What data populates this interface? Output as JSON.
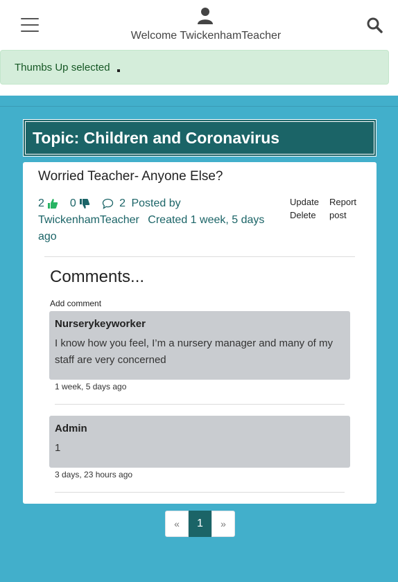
{
  "header": {
    "welcome": "Welcome TwickenhamTeacher"
  },
  "alert": {
    "text": "Thumbs Up selected"
  },
  "topic": {
    "title": "Topic: Children and Coronavirus"
  },
  "post": {
    "title": "Worried Teacher- Anyone Else?",
    "likes": "2",
    "dislikes": "0",
    "comment_count": "2",
    "posted_by_label": "Posted by",
    "author": "TwickenhamTeacher",
    "created": "Created 1 week, 5 days ago",
    "actions": {
      "update": "Update",
      "delete": "Delete",
      "report": "Report post"
    }
  },
  "comments": {
    "title": "Comments...",
    "add_label": "Add comment",
    "items": [
      {
        "author": "Nurserykeyworker",
        "body": "I know how you feel, I’m a nursery manager and many of my staff are very concerned",
        "time": "1 week, 5 days ago"
      },
      {
        "author": "Admin",
        "body": "1",
        "time": "3 days, 23 hours ago"
      }
    ]
  },
  "pagination": {
    "prev": "«",
    "current": "1",
    "next": "»"
  },
  "colors": {
    "brand_dark_teal": "#1b6467",
    "background_blue": "#42afcb",
    "alert_green_bg": "#d4edda",
    "like_green": "#28b463"
  }
}
